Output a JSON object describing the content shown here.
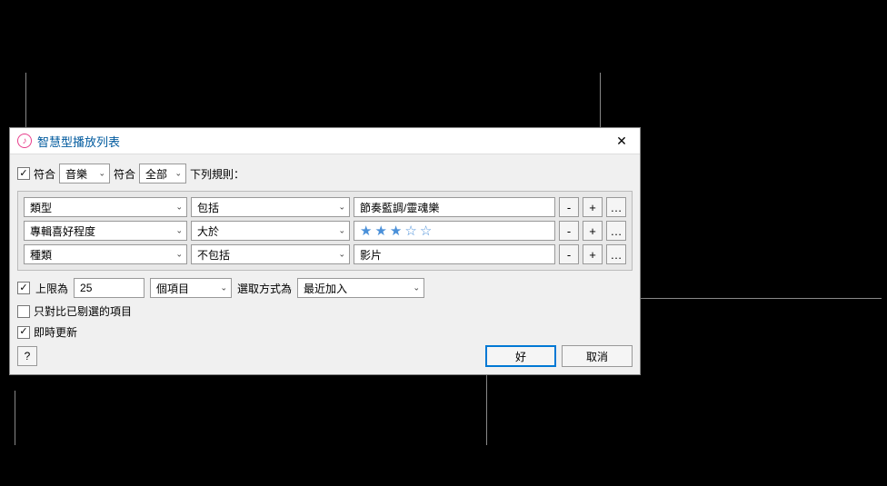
{
  "window": {
    "title": "智慧型播放列表"
  },
  "match": {
    "checkbox_checked": true,
    "label_prefix": "符合",
    "source": "音樂",
    "label_mid": "符合",
    "match_mode": "全部",
    "label_suffix": "下列規則："
  },
  "rules": [
    {
      "field": "類型",
      "operator": "包括",
      "value": "節奏藍調/靈魂樂",
      "value_type": "text"
    },
    {
      "field": "專輯喜好程度",
      "operator": "大於",
      "value": "3",
      "value_type": "stars"
    },
    {
      "field": "種類",
      "operator": "不包括",
      "value": "影片",
      "value_type": "text"
    }
  ],
  "rule_buttons": {
    "remove": "-",
    "add": "+",
    "more": "…"
  },
  "limit": {
    "checked": true,
    "label": "上限為",
    "value": "25",
    "unit": "個項目",
    "selected_by_label": "選取方式為",
    "selected_by": "最近加入"
  },
  "match_only_checked": {
    "checked": false,
    "label": "只對比已剔選的項目"
  },
  "live_update": {
    "checked": true,
    "label": "即時更新"
  },
  "buttons": {
    "help": "?",
    "ok": "好",
    "cancel": "取消"
  }
}
